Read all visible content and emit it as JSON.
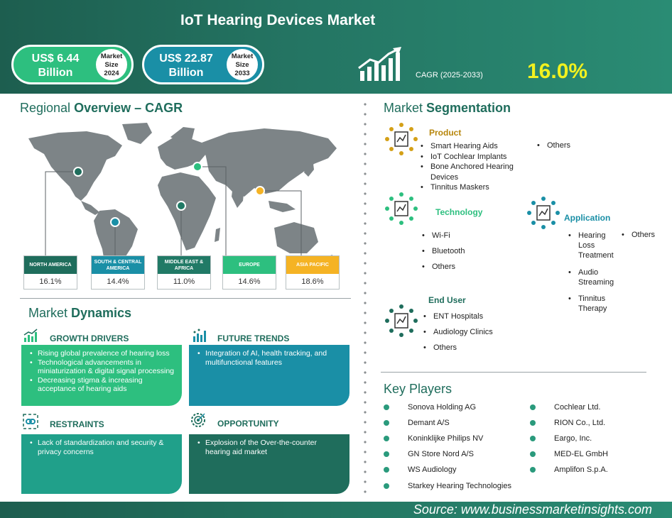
{
  "header": {
    "title": "IoT Hearing Devices Market",
    "market_2024": {
      "amount_line1": "US$ 6.44",
      "amount_line2": "Billion",
      "badge_line1": "Market",
      "badge_line2": "Size",
      "badge_line3": "2024"
    },
    "market_2033": {
      "amount_line1": "US$ 22.87",
      "amount_line2": "Billion",
      "badge_line1": "Market",
      "badge_line2": "Size",
      "badge_line3": "2033"
    },
    "cagr_label": "CAGR (2025-2033)",
    "cagr_value": "16.0%"
  },
  "regional": {
    "heading_light": "Regional ",
    "heading_bold": "Overview – CAGR",
    "regions": [
      {
        "name": "NORTH AMERICA",
        "value": "16.1%",
        "color": "#1f6d5c"
      },
      {
        "name": "SOUTH & CENTRAL AMERICA",
        "value": "14.4%",
        "color": "#1a8fa6"
      },
      {
        "name": "MIDDLE EAST & AFRICA",
        "value": "11.0%",
        "color": "#217a66"
      },
      {
        "name": "EUROPE",
        "value": "14.6%",
        "color": "#2dbf7f"
      },
      {
        "name": "ASIA PACIFIC",
        "value": "18.6%",
        "color": "#f5b324"
      }
    ]
  },
  "dynamics": {
    "heading_light": "Market ",
    "heading_bold": "Dynamics",
    "growth_drivers": {
      "title": "GROWTH DRIVERS",
      "items": [
        "Rising global prevalence of hearing loss",
        "Technological advancements in miniaturization & digital signal processing",
        "Decreasing stigma & increasing acceptance of hearing aids"
      ]
    },
    "future_trends": {
      "title": "FUTURE TRENDS",
      "items": [
        "Integration of AI, health tracking, and multifunctional features"
      ]
    },
    "restraints": {
      "title": "RESTRAINTS",
      "items": [
        "Lack of standardization and security & privacy concerns"
      ]
    },
    "opportunity": {
      "title": "OPPORTUNITY",
      "items": [
        "Explosion of the Over-the-counter hearing aid market"
      ]
    }
  },
  "segmentation": {
    "heading_light": "Market ",
    "heading_bold": "Segmentation",
    "product": {
      "title": "Product",
      "items": [
        "Smart Hearing Aids",
        "IoT Cochlear Implants",
        "Bone Anchored Hearing Devices",
        "Tinnitus Maskers"
      ],
      "items_right": [
        "Others"
      ]
    },
    "technology": {
      "title": "Technology",
      "items": [
        "Wi-Fi",
        "Bluetooth",
        "Others"
      ]
    },
    "application": {
      "title": "Application",
      "items": [
        "Hearing Loss Treatment",
        "Audio Streaming",
        "Tinnitus Therapy"
      ],
      "items_right": [
        "Others"
      ]
    },
    "end_user": {
      "title": "End User",
      "items": [
        "ENT Hospitals",
        "Audiology Clinics",
        "Others"
      ]
    }
  },
  "players": {
    "heading": "Key Players",
    "left": [
      "Sonova Holding AG",
      "Demant A/S",
      "Koninklijke Philips NV",
      "GN Store Nord A/S",
      "WS Audiology",
      "Starkey Hearing Technologies"
    ],
    "right": [
      "Cochlear Ltd.",
      "RION Co., Ltd.",
      "Eargo, Inc.",
      "MED-EL GmbH",
      "Amplifon S.p.A."
    ]
  },
  "footer": {
    "source": "Source:  www.businessmarketinsights.com"
  }
}
